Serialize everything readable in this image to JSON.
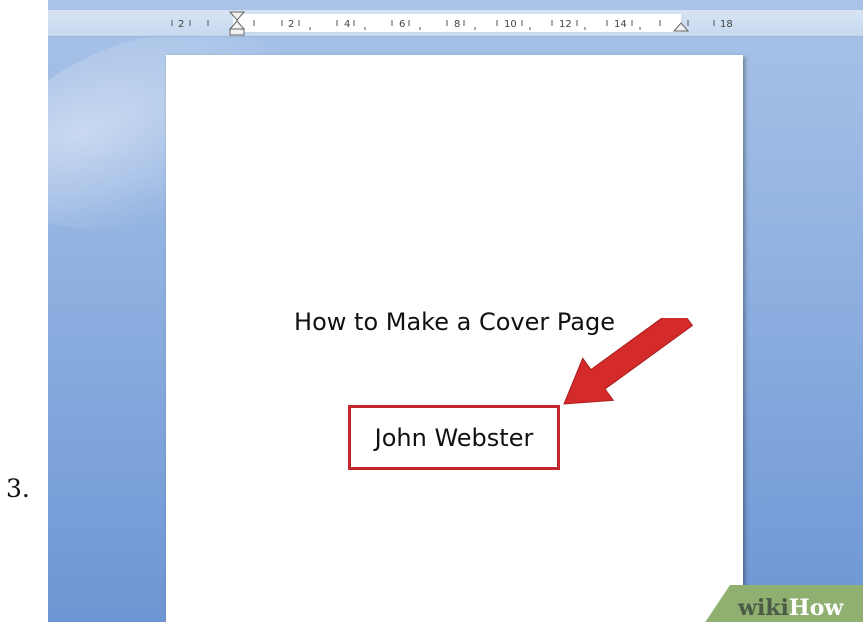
{
  "step": {
    "number": "3."
  },
  "ruler": {
    "labels": [
      "2",
      "2",
      "4",
      "6",
      "8",
      "10",
      "12",
      "14",
      "18"
    ]
  },
  "document": {
    "title": "How to Make a Cover Page",
    "author": "John Webster"
  },
  "annotation": {
    "highlight_color": "#c0262b",
    "arrow_color": "#d42a2a"
  },
  "watermark": {
    "wiki": "wiki",
    "how": "How",
    "color": "#8fb071"
  },
  "colors": {
    "background_blue": "#8fb0e0",
    "page": "#ffffff"
  }
}
